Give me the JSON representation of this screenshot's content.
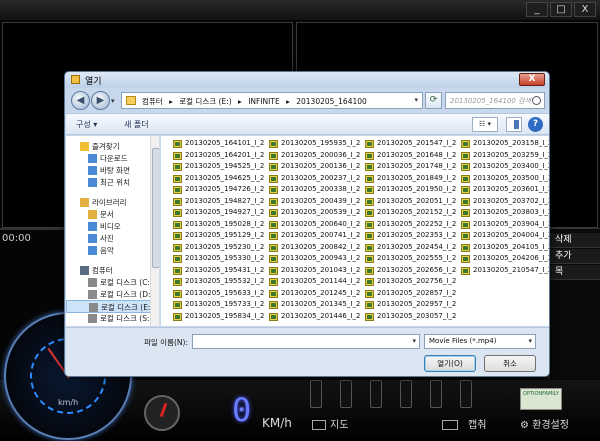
{
  "background_app": {
    "window_buttons": [
      "_",
      "□",
      "X"
    ],
    "time_text": "00:00",
    "right_panel": {
      "delete_label": "삭제",
      "add_label": "추가",
      "list_label": "목"
    },
    "speedometer": {
      "unit": "km/h"
    },
    "digital_speed": "0",
    "speed_unit": "KM/h",
    "map_label": "지도",
    "capture_label": "캡춰",
    "settings_label": "환경설정",
    "logo_text": "OPTIONFAMILY"
  },
  "dialog": {
    "title": "열기",
    "close_label": "X",
    "address_parts": [
      "컴퓨터",
      "▸",
      "로컬 디스크 (E:)",
      "▸",
      "INFINITE",
      "▸",
      "20130205_164100"
    ],
    "search_placeholder": "20130205_164100 검색",
    "toolbar": {
      "organize": "구성 ▾",
      "new_folder": "새 폴더",
      "view": "☷ ▾",
      "help": "?"
    },
    "nav_items": [
      {
        "label": "즐겨찾기",
        "icon": "star-icon",
        "color": "#f0c030"
      },
      {
        "label": "다운로드",
        "icon": "folder-icon",
        "color": "#4a8ad4"
      },
      {
        "label": "바탕 화면",
        "icon": "desktop-icon",
        "color": "#4a8ad4"
      },
      {
        "label": "최근 위치",
        "icon": "recent-icon",
        "color": "#4a8ad4"
      },
      {
        "label": "라이브러리",
        "icon": "library-icon",
        "color": "#e0b040"
      },
      {
        "label": "문서",
        "icon": "document-icon",
        "color": "#e0b040"
      },
      {
        "label": "비디오",
        "icon": "video-icon",
        "color": "#4a8ad4"
      },
      {
        "label": "사진",
        "icon": "picture-icon",
        "color": "#4a8ad4"
      },
      {
        "label": "음악",
        "icon": "music-icon",
        "color": "#4a8ad4"
      },
      {
        "label": "컴퓨터",
        "icon": "computer-icon",
        "color": "#5a6a80"
      },
      {
        "label": "로컬 디스크 (C:)",
        "icon": "drive-icon",
        "color": "#8a8a8a"
      },
      {
        "label": "로컬 디스크 (D:)",
        "icon": "drive-icon",
        "color": "#8a8a8a"
      },
      {
        "label": "로컬 디스크 (E:)",
        "icon": "drive-icon",
        "color": "#8a8a8a"
      },
      {
        "label": "로컬 디스크 (S:)",
        "icon": "drive-icon",
        "color": "#8a8a8a"
      }
    ],
    "files": [
      [
        "20130205_164101_I_2",
        "20130205_195935_I_2",
        "20130205_201547_I_2",
        "20130205_203158_I_2"
      ],
      [
        "20130205_164201_I_2",
        "20130205_200036_I_2",
        "20130205_201648_I_2",
        "20130205_203259_I_2"
      ],
      [
        "20130205_194525_I_2",
        "20130205_200136_I_2",
        "20130205_201748_I_2",
        "20130205_203400_I_2"
      ],
      [
        "20130205_194625_I_2",
        "20130205_200237_I_2",
        "20130205_201849_I_2",
        "20130205_203500_I_2"
      ],
      [
        "20130205_194726_I_2",
        "20130205_200338_I_2",
        "20130205_201950_I_2",
        "20130205_203601_I_2"
      ],
      [
        "20130205_194827_I_2",
        "20130205_200439_I_2",
        "20130205_202051_I_2",
        "20130205_203702_I_2"
      ],
      [
        "20130205_194927_I_2",
        "20130205_200539_I_2",
        "20130205_202152_I_2",
        "20130205_203803_I_2"
      ],
      [
        "20130205_195028_I_2",
        "20130205_200640_I_2",
        "20130205_202252_I_2",
        "20130205_203904_I_2"
      ],
      [
        "20130205_195129_I_2",
        "20130205_200741_I_2",
        "20130205_202353_I_2",
        "20130205_204004_I_2"
      ],
      [
        "20130205_195230_I_2",
        "20130205_200842_I_2",
        "20130205_202454_I_2",
        "20130205_204105_I_2"
      ],
      [
        "20130205_195330_I_2",
        "20130205_200943_I_2",
        "20130205_202555_I_2",
        "20130205_204206_I_2"
      ],
      [
        "20130205_195431_I_2",
        "20130205_201043_I_2",
        "20130205_202656_I_2",
        "20130205_210547_I_2"
      ],
      [
        "20130205_195532_I_2",
        "20130205_201144_I_2",
        "20130205_202756_I_2",
        ""
      ],
      [
        "20130205_195633_I_2",
        "20130205_201245_I_2",
        "20130205_202857_I_2",
        ""
      ],
      [
        "20130205_195733_I_2",
        "20130205_201345_I_2",
        "20130205_202957_I_2",
        ""
      ],
      [
        "20130205_195834_I_2",
        "20130205_201446_I_2",
        "20130205_203057_I_2",
        ""
      ]
    ],
    "filename_label": "파일 이름(N):",
    "filename_value": "",
    "filter_value": "Movie Files (*.mp4)",
    "open_label": "열기(O)",
    "cancel_label": "취소"
  }
}
